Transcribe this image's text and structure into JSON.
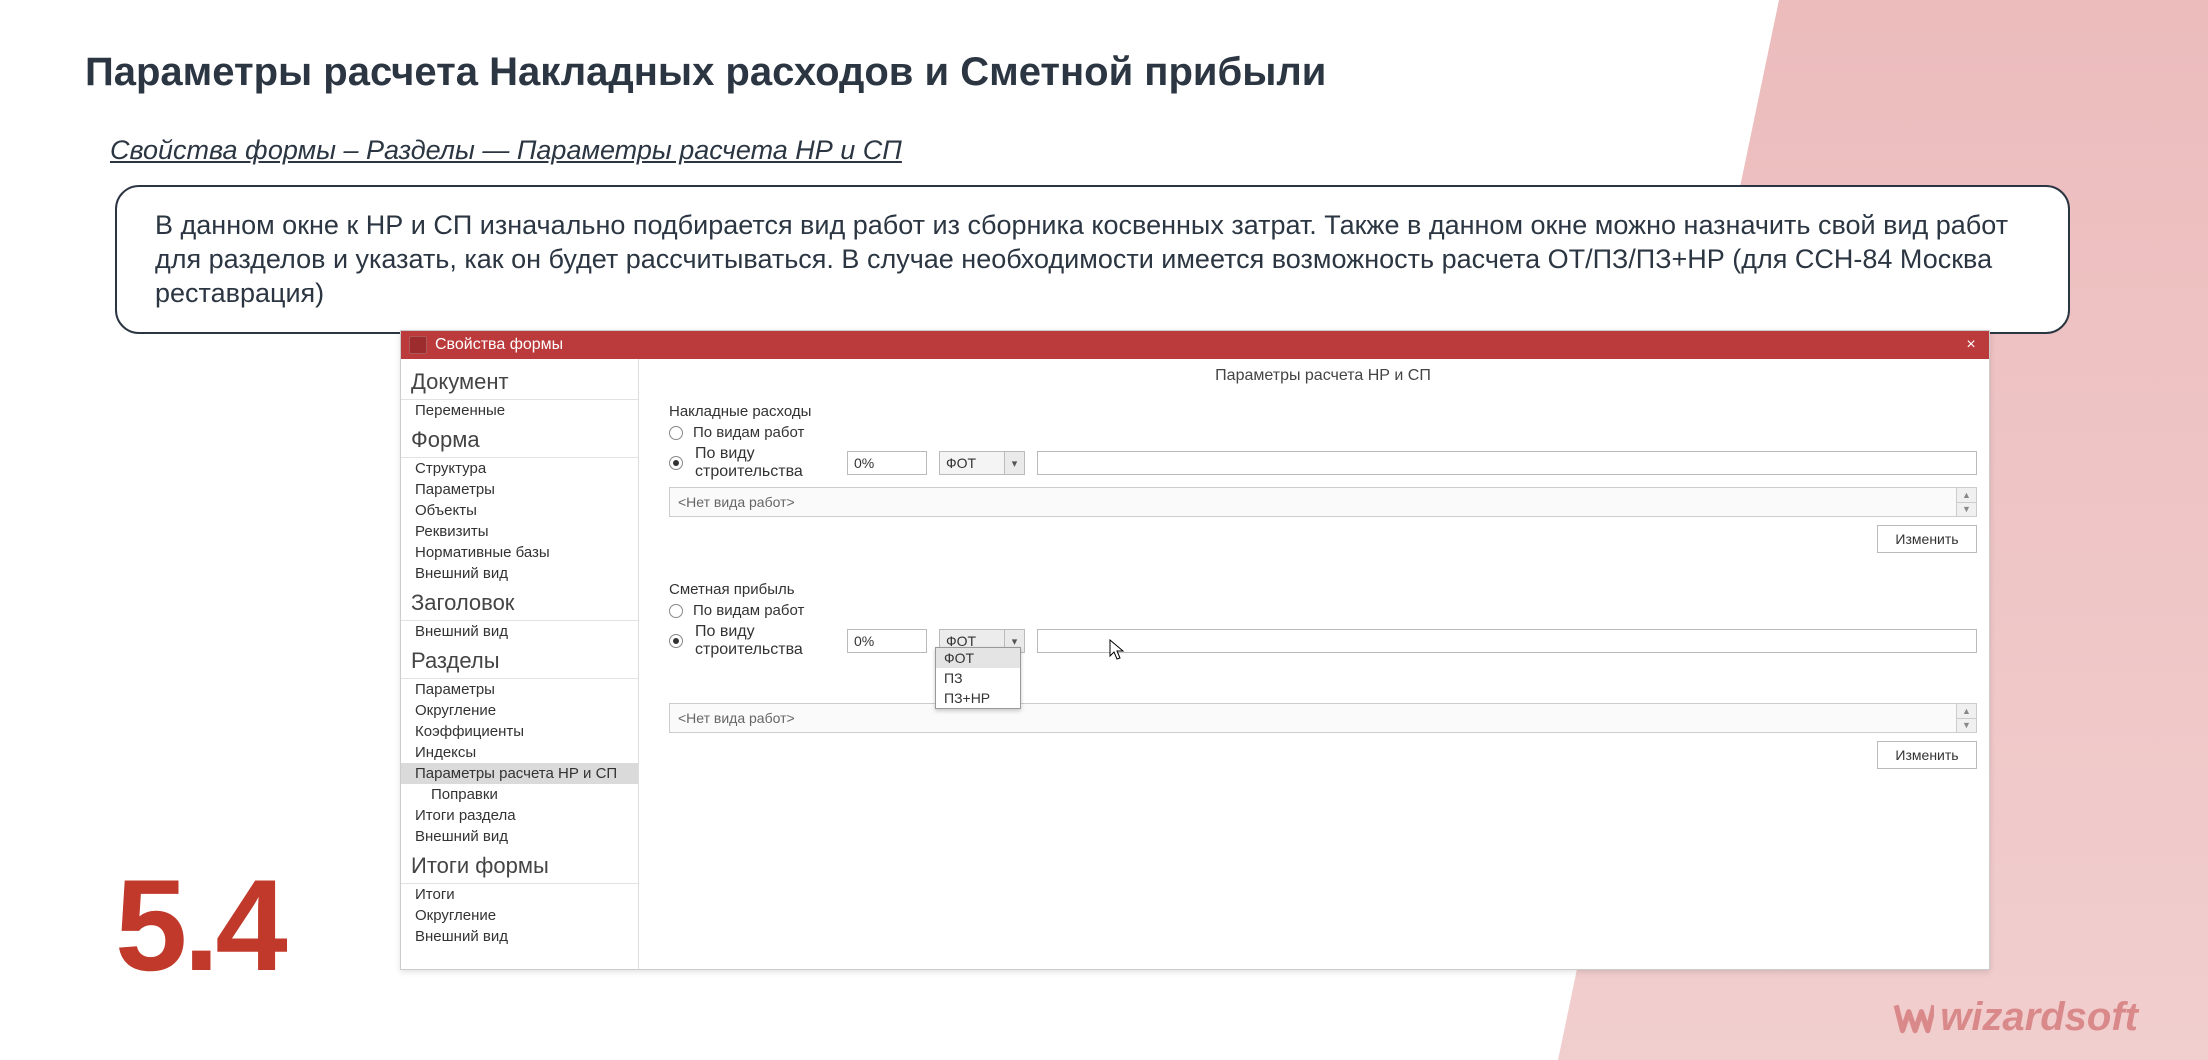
{
  "page": {
    "title": "Параметры расчета Накладных расходов и Сметной прибыли",
    "breadcrumb": "Свойства формы – Разделы — Параметры расчета НР и СП",
    "description": "В данном окне к НР и СП изначально подбирается вид работ из сборника косвенных затрат. Также в данном окне можно назначить свой вид работ для разделов и указать, как он будет рассчитываться. В случае необходимости имеется возможность расчета ОТ/ПЗ/ПЗ+НР (для ССН-84 Москва реставрация)",
    "section_number": "5.4",
    "brand": "wizardsoft"
  },
  "window": {
    "title": "Свойства формы",
    "main_title": "Параметры расчета НР и СП"
  },
  "sidebar": {
    "groups": [
      {
        "title": "Документ",
        "items": [
          "Переменные"
        ]
      },
      {
        "title": "Форма",
        "items": [
          "Структура",
          "Параметры",
          "Объекты",
          "Реквизиты",
          "Нормативные базы",
          "Внешний вид"
        ]
      },
      {
        "title": "Заголовок",
        "items": [
          "Внешний вид"
        ]
      },
      {
        "title": "Разделы",
        "items": [
          "Параметры",
          "Округление",
          "Коэффициенты",
          "Индексы",
          "Параметры расчета НР и СП",
          "Поправки",
          "Итоги раздела",
          "Внешний вид"
        ],
        "active_index": 4,
        "indent_index": 5
      },
      {
        "title": "Итоги формы",
        "items": [
          "Итоги",
          "Округление",
          "Внешний вид"
        ]
      }
    ]
  },
  "nr": {
    "group_label": "Накладные расходы",
    "radio1": "По видам работ",
    "radio2": "По виду строительства",
    "percent": "0%",
    "select_value": "ФОТ",
    "list_placeholder": "<Нет вида работ>",
    "change": "Изменить"
  },
  "sp": {
    "group_label": "Сметная прибыль",
    "radio1": "По видам работ",
    "radio2": "По виду строительства",
    "percent": "0%",
    "select_value": "ФОТ",
    "list_placeholder": "<Нет вида работ>",
    "change": "Изменить"
  },
  "dropdown": {
    "options": [
      "ФОТ",
      "ПЗ",
      "ПЗ+НР"
    ]
  }
}
